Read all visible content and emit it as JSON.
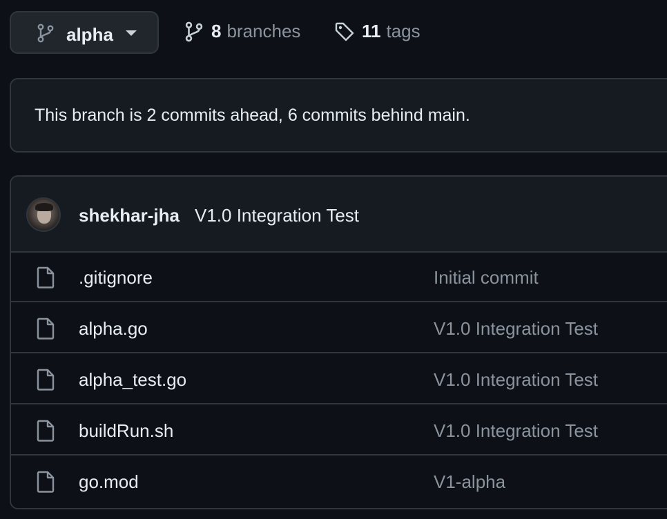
{
  "branch_selector": {
    "label": "alpha"
  },
  "branches": {
    "count": "8",
    "label": "branches"
  },
  "tags": {
    "count": "11",
    "label": "tags"
  },
  "banner": {
    "text": "This branch is 2 commits ahead, 6 commits behind main."
  },
  "latest_commit": {
    "author": "shekhar-jha",
    "message": "V1.0 Integration Test"
  },
  "files": [
    {
      "name": ".gitignore",
      "message": "Initial commit"
    },
    {
      "name": "alpha.go",
      "message": "V1.0 Integration Test"
    },
    {
      "name": "alpha_test.go",
      "message": "V1.0 Integration Test"
    },
    {
      "name": "buildRun.sh",
      "message": "V1.0 Integration Test"
    },
    {
      "name": "go.mod",
      "message": "V1-alpha"
    }
  ]
}
